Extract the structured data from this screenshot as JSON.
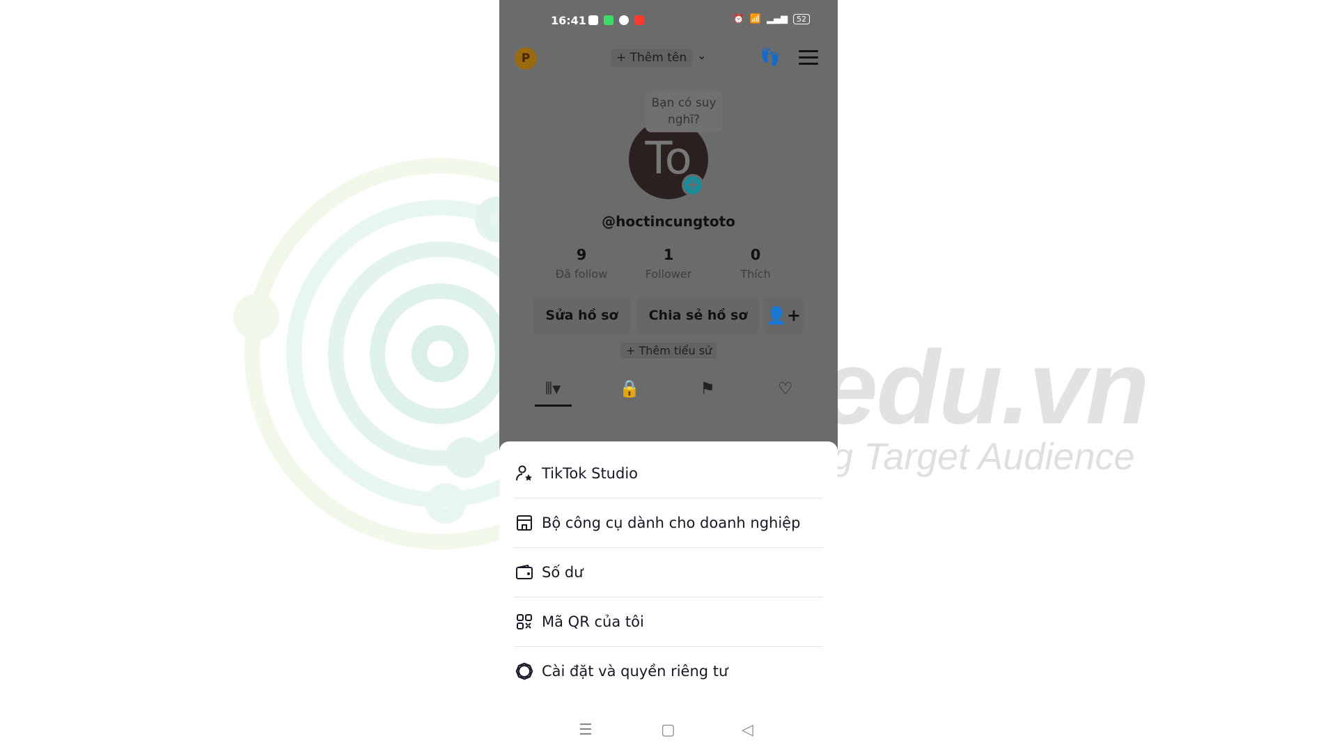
{
  "watermark": {
    "brand": "IMTA.edu.vn",
    "tagline": "Internet Marketing Target Audience",
    "colors": [
      "#bfe3d8",
      "#e4f0d0"
    ]
  },
  "status_bar": {
    "time": "16:41",
    "battery": "52",
    "icons": [
      "shopee-icon",
      "messages-icon",
      "tiktok-icon",
      "app-icon",
      "alarm-icon",
      "wifi-icon",
      "signal-icon",
      "battery-icon"
    ]
  },
  "header": {
    "badge": "P",
    "add_name": "+ Thêm tên"
  },
  "profile": {
    "thought_bubble": "Bạn có suy nghĩ?",
    "avatar_text": "To",
    "username": "@hoctincungtoto",
    "stats": [
      {
        "value": "9",
        "label": "Đã follow"
      },
      {
        "value": "1",
        "label": "Follower"
      },
      {
        "value": "0",
        "label": "Thích"
      }
    ],
    "edit_profile": "Sửa hồ sơ",
    "share_profile": "Chia sẻ hồ sơ",
    "add_bio": "+ Thêm tiểu sử"
  },
  "menu_sheet": {
    "items": [
      {
        "label": "TikTok Studio",
        "icon": "creator-star-icon"
      },
      {
        "label": "Bộ công cụ dành cho doanh nghiệp",
        "icon": "store-icon"
      },
      {
        "label": "Số dư",
        "icon": "wallet-icon"
      },
      {
        "label": "Mã QR của tôi",
        "icon": "qr-code-icon"
      },
      {
        "label": "Cài đặt và quyền riêng tư",
        "icon": "settings-icon"
      }
    ]
  },
  "colors": {
    "accent": "#20d5ec",
    "overlay": "#1e1e1e",
    "badge": "#e8a317"
  }
}
